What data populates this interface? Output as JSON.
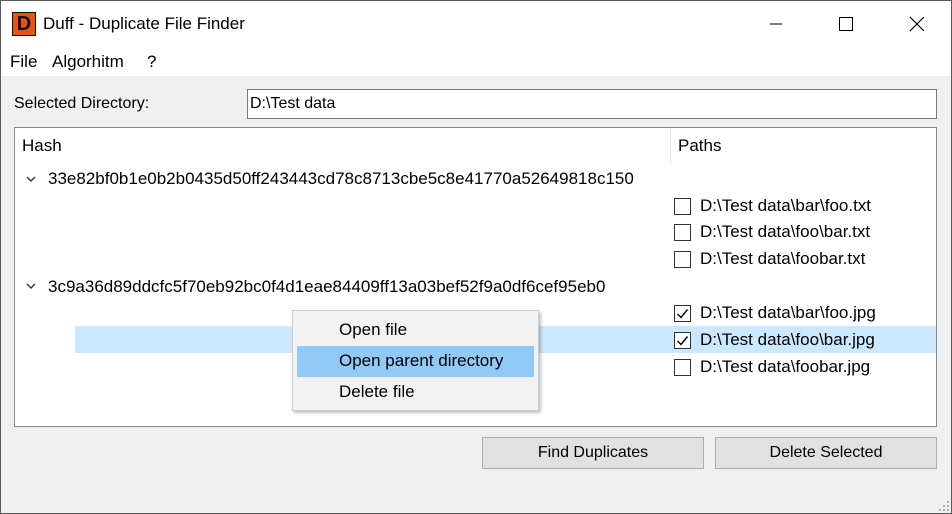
{
  "window": {
    "title": "Duff - Duplicate File Finder",
    "app_icon_letter": "D",
    "app_icon_color": "#e8530f",
    "controls": [
      "minimize-icon",
      "maximize-icon",
      "close-icon"
    ]
  },
  "menu": {
    "items": [
      "File",
      "Algorhitm",
      "?"
    ]
  },
  "directory": {
    "label": "Selected Directory:",
    "value": "D:\\Test data"
  },
  "tree": {
    "headers": {
      "hash": "Hash",
      "paths": "Paths"
    },
    "groups": [
      {
        "hash": "33e82bf0b1e0b2b0435d50ff243443cd78c8713cbe5c8e41770a52649818c150",
        "expanded": true,
        "files": [
          {
            "path": "D:\\Test data\\bar\\foo.txt",
            "checked": false
          },
          {
            "path": "D:\\Test data\\foo\\bar.txt",
            "checked": false
          },
          {
            "path": "D:\\Test data\\foobar.txt",
            "checked": false
          }
        ]
      },
      {
        "hash": "3c9a36d89ddcfc5f70eb92bc0f4d1eae84409ff13a03bef52f9a0df6cef95eb0",
        "expanded": true,
        "files": [
          {
            "path": "D:\\Test data\\bar\\foo.jpg",
            "checked": true
          },
          {
            "path": "D:\\Test data\\foo\\bar.jpg",
            "checked": true,
            "selected": true
          },
          {
            "path": "D:\\Test data\\foobar.jpg",
            "checked": false
          }
        ]
      }
    ],
    "selection_color": "#cce8ff"
  },
  "context_menu": {
    "items": [
      "Open file",
      "Open parent directory",
      "Delete file"
    ],
    "highlighted": "Open parent directory",
    "highlight_color": "#91c9f7"
  },
  "buttons": {
    "find": "Find Duplicates",
    "delete": "Delete Selected"
  }
}
